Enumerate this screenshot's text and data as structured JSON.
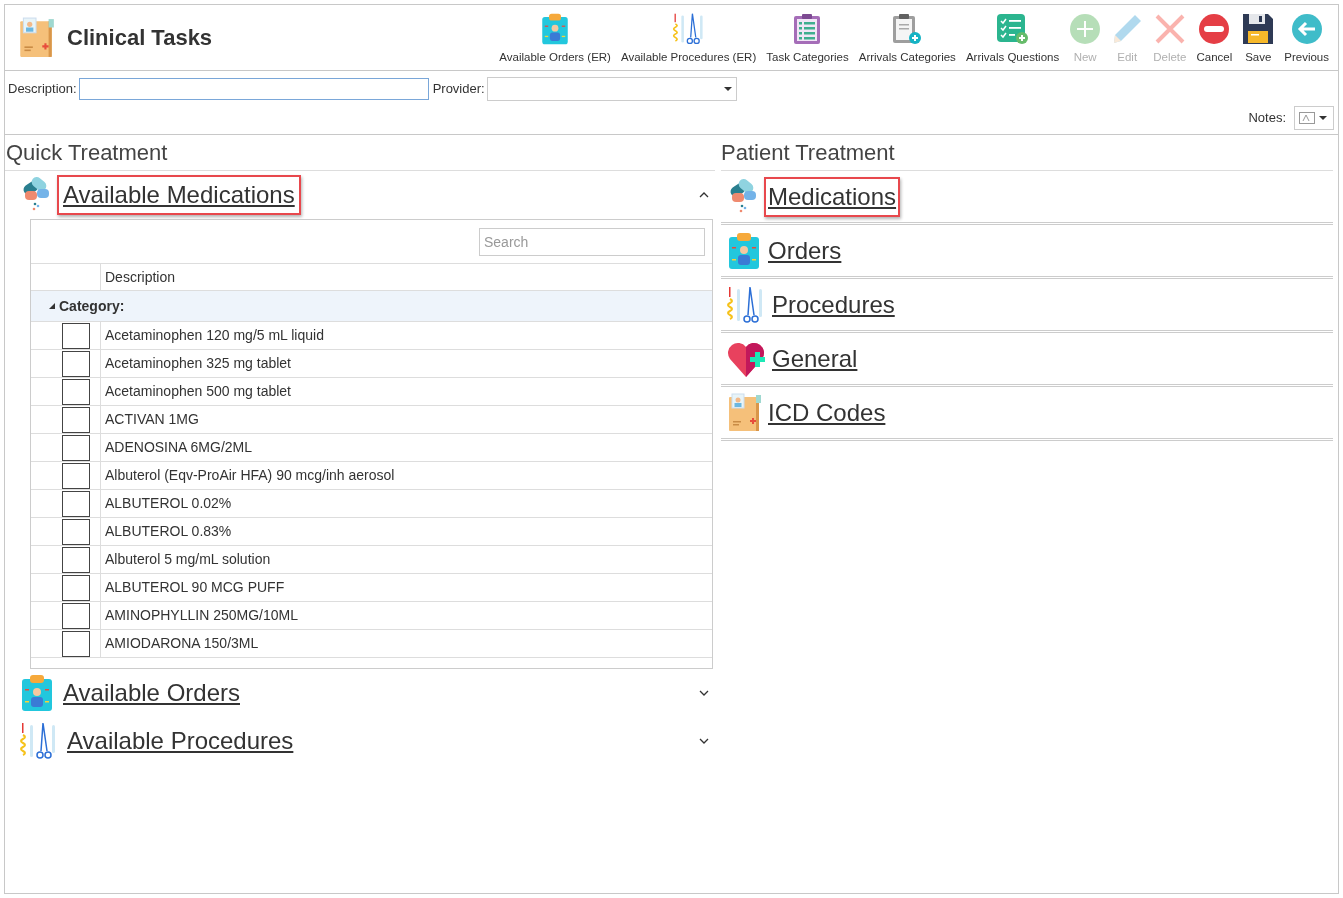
{
  "app": {
    "title": "Clinical Tasks"
  },
  "toolbar": [
    {
      "label": "Available Orders (ER)",
      "disabled": false
    },
    {
      "label": "Available Procedures (ER)",
      "disabled": false
    },
    {
      "label": "Task Categories",
      "disabled": false
    },
    {
      "label": "Arrivals Categories",
      "disabled": false
    },
    {
      "label": "Arrivals Questions",
      "disabled": false
    },
    {
      "label": "New",
      "disabled": true
    },
    {
      "label": "Edit",
      "disabled": true
    },
    {
      "label": "Delete",
      "disabled": true
    },
    {
      "label": "Cancel",
      "disabled": false
    },
    {
      "label": "Save",
      "disabled": false
    },
    {
      "label": "Previous",
      "disabled": false
    }
  ],
  "form": {
    "description_label": "Description:",
    "provider_label": "Provider:",
    "notes_label": "Notes:"
  },
  "quick_treatment": {
    "heading": "Quick Treatment",
    "sections": [
      {
        "title": "Available Medications",
        "expanded": true,
        "highlighted": true
      },
      {
        "title": "Available Orders",
        "expanded": false,
        "highlighted": false
      },
      {
        "title": "Available Procedures",
        "expanded": false,
        "highlighted": false
      }
    ],
    "search": {
      "placeholder": "Search"
    },
    "table": {
      "columns": [
        "Description"
      ],
      "group": "Category:",
      "rows": [
        {
          "description": "Acetaminophen 120 mg/5 mL liquid",
          "checked": false
        },
        {
          "description": "Acetaminophen 325 mg tablet",
          "checked": false
        },
        {
          "description": "Acetaminophen 500 mg tablet",
          "checked": false
        },
        {
          "description": "ACTIVAN 1MG",
          "checked": false
        },
        {
          "description": "ADENOSINA 6MG/2ML",
          "checked": false
        },
        {
          "description": "Albuterol (Eqv-ProAir HFA) 90 mcg/inh aerosol",
          "checked": false
        },
        {
          "description": "ALBUTEROL 0.02%",
          "checked": false
        },
        {
          "description": "ALBUTEROL 0.83%",
          "checked": false
        },
        {
          "description": "Albuterol 5 mg/mL solution",
          "checked": false
        },
        {
          "description": "ALBUTEROL 90 MCG PUFF",
          "checked": false
        },
        {
          "description": "AMINOPHYLLIN 250MG/10ML",
          "checked": false
        },
        {
          "description": "AMIODARONA 150/3ML",
          "checked": false
        }
      ]
    }
  },
  "patient_treatment": {
    "heading": "Patient Treatment",
    "items": [
      {
        "title": "Medications",
        "highlighted": true
      },
      {
        "title": "Orders",
        "highlighted": false
      },
      {
        "title": "Procedures",
        "highlighted": false
      },
      {
        "title": "General",
        "highlighted": false
      },
      {
        "title": "ICD Codes",
        "highlighted": false
      }
    ]
  }
}
